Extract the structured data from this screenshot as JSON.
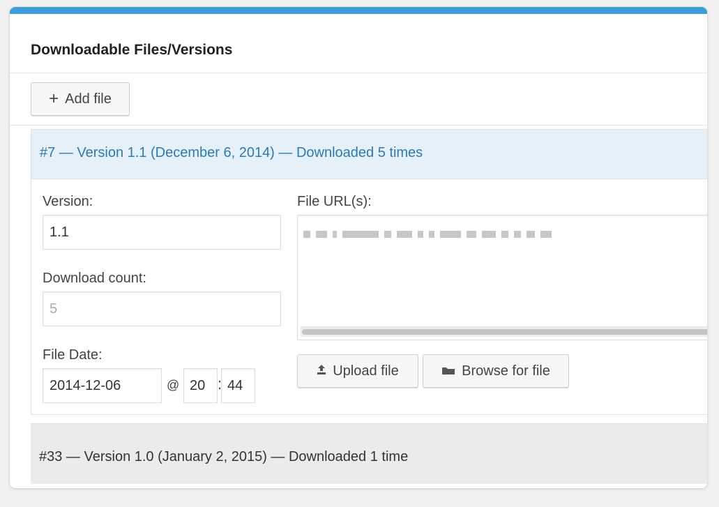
{
  "panel": {
    "title": "Downloadable Files/Versions"
  },
  "toolbar": {
    "add_label": "Add file"
  },
  "files": [
    {
      "header": "#7 — Version 1.1 (December 6, 2014) — Downloaded 5 times",
      "version_label": "Version:",
      "version_value": "1.1",
      "download_count_label": "Download count:",
      "download_count_value": "5",
      "file_date_label": "File Date:",
      "date_value": "2014-12-06",
      "at_symbol": "@",
      "hour": "20",
      "colon": ":",
      "minute": "44",
      "file_urls_label": "File URL(s):",
      "upload_label": "Upload file",
      "browse_label": "Browse for file"
    },
    {
      "header": "#33 — Version 1.0 (January 2, 2015) — Downloaded 1 time"
    }
  ],
  "icons": {
    "add": "plus-icon",
    "upload": "upload-icon",
    "browse": "folder-icon"
  },
  "colors": {
    "accent": "#3d9ed8",
    "open_header_bg": "#e6f0f8",
    "open_header_text": "#2a7ab8",
    "closed_header_bg": "#ebebeb"
  }
}
